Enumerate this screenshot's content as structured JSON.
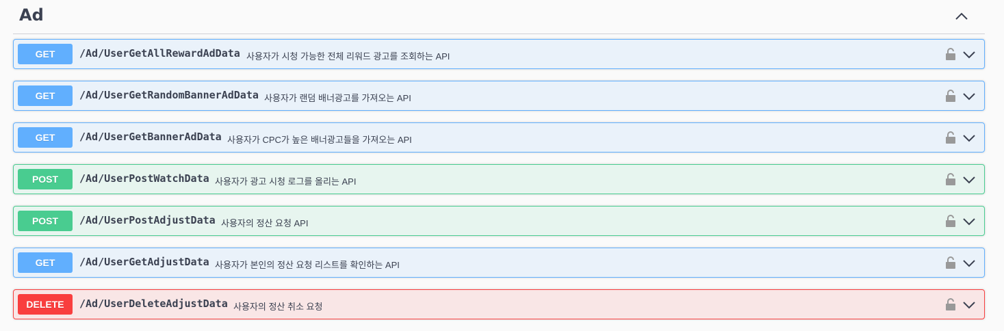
{
  "section": {
    "title": "Ad"
  },
  "operations": [
    {
      "method": "GET",
      "path": "/Ad/UserGetAllRewardAdData",
      "summary": "사용자가 시청 가능한 전체 리워드 광고를 조회하는 API"
    },
    {
      "method": "GET",
      "path": "/Ad/UserGetRandomBannerAdData",
      "summary": "사용자가 랜덤 배너광고를 가져오는 API"
    },
    {
      "method": "GET",
      "path": "/Ad/UserGetBannerAdData",
      "summary": "사용자가 CPC가 높은 배너광고들을 가져오는 API"
    },
    {
      "method": "POST",
      "path": "/Ad/UserPostWatchData",
      "summary": "사용자가 광고 시청 로그를 올리는 API"
    },
    {
      "method": "POST",
      "path": "/Ad/UserPostAdjustData",
      "summary": "사용자의 정산 요청 API"
    },
    {
      "method": "GET",
      "path": "/Ad/UserGetAdjustData",
      "summary": "사용자가 본인의 정산 요청 리스트를 확인하는 API"
    },
    {
      "method": "DELETE",
      "path": "/Ad/UserDeleteAdjustData",
      "summary": "사용자의 정산 취소 요청"
    }
  ],
  "colors": {
    "get": "#61affe",
    "post": "#49cc90",
    "delete": "#f93e3e"
  },
  "icons": {
    "collapse": "chevron-up-icon",
    "lock": "lock-icon",
    "expand": "chevron-down-icon"
  }
}
